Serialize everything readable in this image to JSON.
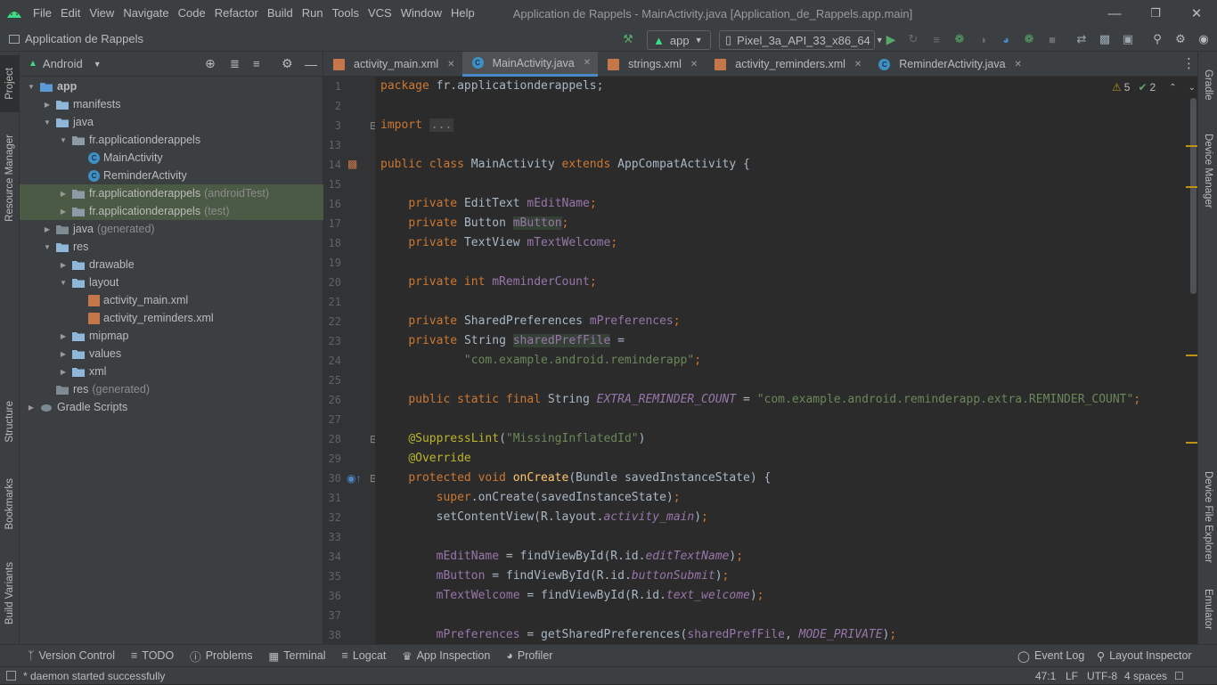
{
  "menu": {
    "items": [
      "File",
      "Edit",
      "View",
      "Navigate",
      "Code",
      "Refactor",
      "Build",
      "Run",
      "Tools",
      "VCS",
      "Window",
      "Help"
    ],
    "window_title": "Application de Rappels - MainActivity.java [Application_de_Rappels.app.main]"
  },
  "navbar": {
    "project_name": "Application de Rappels",
    "run_config": "app",
    "device": "Pixel_3a_API_33_x86_64"
  },
  "left_strip": [
    "Project",
    "Resource Manager",
    "Structure",
    "Bookmarks",
    "Build Variants"
  ],
  "right_strip": [
    "Gradle",
    "Device Manager",
    "Device File Explorer",
    "Emulator"
  ],
  "project_panel": {
    "view_mode": "Android",
    "tree": [
      {
        "label": "app",
        "muted": "",
        "depth": 0,
        "icon": "folder",
        "arrow": "down",
        "selected": false
      },
      {
        "label": "manifests",
        "muted": "",
        "depth": 1,
        "icon": "folder",
        "arrow": "right",
        "selected": false
      },
      {
        "label": "java",
        "muted": "",
        "depth": 1,
        "icon": "folder",
        "arrow": "down",
        "selected": false
      },
      {
        "label": "fr.applicationderappels",
        "muted": "",
        "depth": 2,
        "icon": "package",
        "arrow": "down",
        "selected": false
      },
      {
        "label": "MainActivity",
        "muted": "",
        "depth": 3,
        "icon": "class",
        "arrow": "",
        "selected": false
      },
      {
        "label": "ReminderActivity",
        "muted": "",
        "depth": 3,
        "icon": "class",
        "arrow": "",
        "selected": false
      },
      {
        "label": "fr.applicationderappels",
        "muted": "(androidTest)",
        "depth": 2,
        "icon": "package",
        "arrow": "right",
        "selected": true
      },
      {
        "label": "fr.applicationderappels",
        "muted": "(test)",
        "depth": 2,
        "icon": "package",
        "arrow": "right",
        "selected": true
      },
      {
        "label": "java",
        "muted": "(generated)",
        "depth": 1,
        "icon": "folder-gen",
        "arrow": "right",
        "selected": false
      },
      {
        "label": "res",
        "muted": "",
        "depth": 1,
        "icon": "folder",
        "arrow": "down",
        "selected": false
      },
      {
        "label": "drawable",
        "muted": "",
        "depth": 2,
        "icon": "folder",
        "arrow": "right",
        "selected": false
      },
      {
        "label": "layout",
        "muted": "",
        "depth": 2,
        "icon": "folder",
        "arrow": "down",
        "selected": false
      },
      {
        "label": "activity_main.xml",
        "muted": "",
        "depth": 3,
        "icon": "xml",
        "arrow": "",
        "selected": false
      },
      {
        "label": "activity_reminders.xml",
        "muted": "",
        "depth": 3,
        "icon": "xml",
        "arrow": "",
        "selected": false
      },
      {
        "label": "mipmap",
        "muted": "",
        "depth": 2,
        "icon": "folder",
        "arrow": "right",
        "selected": false
      },
      {
        "label": "values",
        "muted": "",
        "depth": 2,
        "icon": "folder",
        "arrow": "right",
        "selected": false
      },
      {
        "label": "xml",
        "muted": "",
        "depth": 2,
        "icon": "folder",
        "arrow": "right",
        "selected": false
      },
      {
        "label": "res",
        "muted": "(generated)",
        "depth": 1,
        "icon": "folder-gen",
        "arrow": "",
        "selected": false
      },
      {
        "label": "Gradle Scripts",
        "muted": "",
        "depth": 0,
        "icon": "gradle",
        "arrow": "right",
        "selected": false
      }
    ]
  },
  "tabs": [
    {
      "label": "activity_main.xml",
      "icon": "xml",
      "active": false
    },
    {
      "label": "MainActivity.java",
      "icon": "class",
      "active": true
    },
    {
      "label": "strings.xml",
      "icon": "xml",
      "active": false
    },
    {
      "label": "activity_reminders.xml",
      "icon": "xml",
      "active": false
    },
    {
      "label": "ReminderActivity.java",
      "icon": "class",
      "active": false
    }
  ],
  "inspections": {
    "warnings": "5",
    "weak_warnings": "2"
  },
  "code": [
    {
      "n": "1",
      "t": [
        [
          "kw",
          "package "
        ],
        [
          "",
          "fr.applicationderappels;"
        ]
      ]
    },
    {
      "n": "2",
      "t": []
    },
    {
      "n": "3",
      "t": [
        [
          "kw",
          "import "
        ],
        [
          "gr",
          "..."
        ]
      ]
    },
    {
      "n": "13",
      "t": []
    },
    {
      "n": "14",
      "t": [
        [
          "kw",
          "public class "
        ],
        [
          "",
          "MainActivity "
        ],
        [
          "kw",
          "extends "
        ],
        [
          "",
          "AppCompatActivity {"
        ]
      ]
    },
    {
      "n": "15",
      "t": []
    },
    {
      "n": "16",
      "t": [
        [
          "",
          "    "
        ],
        [
          "kw",
          "private "
        ],
        [
          "",
          "EditText "
        ],
        [
          "fd",
          "mEditName"
        ],
        [
          "kw",
          ";"
        ]
      ]
    },
    {
      "n": "17",
      "t": [
        [
          "",
          "    "
        ],
        [
          "kw",
          "private "
        ],
        [
          "",
          "Button "
        ],
        [
          "fdh",
          "mButton"
        ],
        [
          "kw",
          ";"
        ]
      ]
    },
    {
      "n": "18",
      "t": [
        [
          "",
          "    "
        ],
        [
          "kw",
          "private "
        ],
        [
          "",
          "TextView "
        ],
        [
          "fd",
          "mTextWelcome"
        ],
        [
          "kw",
          ";"
        ]
      ]
    },
    {
      "n": "19",
      "t": []
    },
    {
      "n": "20",
      "t": [
        [
          "",
          "    "
        ],
        [
          "kw",
          "private int "
        ],
        [
          "fd",
          "mReminderCount"
        ],
        [
          "kw",
          ";"
        ]
      ]
    },
    {
      "n": "21",
      "t": []
    },
    {
      "n": "22",
      "t": [
        [
          "",
          "    "
        ],
        [
          "kw",
          "private "
        ],
        [
          "",
          "SharedPreferences "
        ],
        [
          "fd",
          "mPreferences"
        ],
        [
          "kw",
          ";"
        ]
      ]
    },
    {
      "n": "23",
      "t": [
        [
          "",
          "    "
        ],
        [
          "kw",
          "private "
        ],
        [
          "",
          "String "
        ],
        [
          "fdh",
          "sharedPrefFile"
        ],
        [
          "",
          " ="
        ]
      ]
    },
    {
      "n": "24",
      "t": [
        [
          "",
          "            "
        ],
        [
          "st",
          "\"com.example.android.reminderapp\""
        ],
        [
          "kw",
          ";"
        ]
      ]
    },
    {
      "n": "25",
      "t": []
    },
    {
      "n": "26",
      "t": [
        [
          "",
          "    "
        ],
        [
          "kw",
          "public static final "
        ],
        [
          "",
          "String "
        ],
        [
          "it",
          "EXTRA_REMINDER_COUNT"
        ],
        [
          "",
          " = "
        ],
        [
          "st",
          "\"com.example.android.reminderapp.extra.REMINDER_COUNT\""
        ],
        [
          "kw",
          ";"
        ]
      ]
    },
    {
      "n": "27",
      "t": []
    },
    {
      "n": "28",
      "t": [
        [
          "",
          "    "
        ],
        [
          "an",
          "@SuppressLint"
        ],
        [
          "",
          "("
        ],
        [
          "st",
          "\"MissingInflatedId\""
        ],
        [
          "",
          ")"
        ]
      ]
    },
    {
      "n": "29",
      "t": [
        [
          "",
          "    "
        ],
        [
          "an",
          "@Override"
        ]
      ]
    },
    {
      "n": "30",
      "t": [
        [
          "",
          "    "
        ],
        [
          "kw",
          "protected void "
        ],
        [
          "fn",
          "onCreate"
        ],
        [
          "",
          "(Bundle savedInstanceState) {"
        ]
      ]
    },
    {
      "n": "31",
      "t": [
        [
          "",
          "        "
        ],
        [
          "kw",
          "super"
        ],
        [
          "",
          ".onCreate(savedInstanceState)"
        ],
        [
          "kw",
          ";"
        ]
      ]
    },
    {
      "n": "32",
      "t": [
        [
          "",
          "        setContentView(R.layout."
        ],
        [
          "it",
          "activity_main"
        ],
        [
          "",
          ")"
        ],
        [
          "kw",
          ";"
        ]
      ]
    },
    {
      "n": "33",
      "t": []
    },
    {
      "n": "34",
      "t": [
        [
          "",
          "        "
        ],
        [
          "fd",
          "mEditName"
        ],
        [
          "",
          " = findViewById(R.id."
        ],
        [
          "it",
          "editTextName"
        ],
        [
          "",
          ")"
        ],
        [
          "kw",
          ";"
        ]
      ]
    },
    {
      "n": "35",
      "t": [
        [
          "",
          "        "
        ],
        [
          "fd",
          "mButton"
        ],
        [
          "",
          " = findViewById(R.id."
        ],
        [
          "it",
          "buttonSubmit"
        ],
        [
          "",
          ")"
        ],
        [
          "kw",
          ";"
        ]
      ]
    },
    {
      "n": "36",
      "t": [
        [
          "",
          "        "
        ],
        [
          "fd",
          "mTextWelcome"
        ],
        [
          "",
          " = findViewById(R.id."
        ],
        [
          "it",
          "text_welcome"
        ],
        [
          "",
          ")"
        ],
        [
          "kw",
          ";"
        ]
      ]
    },
    {
      "n": "37",
      "t": []
    },
    {
      "n": "38",
      "t": [
        [
          "",
          "        "
        ],
        [
          "fd",
          "mPreferences"
        ],
        [
          "",
          " = getSharedPreferences("
        ],
        [
          "fd",
          "sharedPrefFile"
        ],
        [
          "",
          ", "
        ],
        [
          "it",
          "MODE_PRIVATE"
        ],
        [
          "",
          ")"
        ],
        [
          "kw",
          ";"
        ]
      ]
    }
  ],
  "bottom_tools": [
    "Version Control",
    "TODO",
    "Problems",
    "Terminal",
    "Logcat",
    "App Inspection",
    "Profiler"
  ],
  "bottom_right_tools": [
    "Event Log",
    "Layout Inspector"
  ],
  "status": {
    "message": "* daemon started successfully",
    "position": "47:1",
    "line_sep": "LF",
    "encoding": "UTF-8",
    "indent": "4 spaces"
  },
  "colors": {
    "accent": "#4a88c7",
    "android_green": "#3ddc84",
    "run_green": "#59a869"
  }
}
